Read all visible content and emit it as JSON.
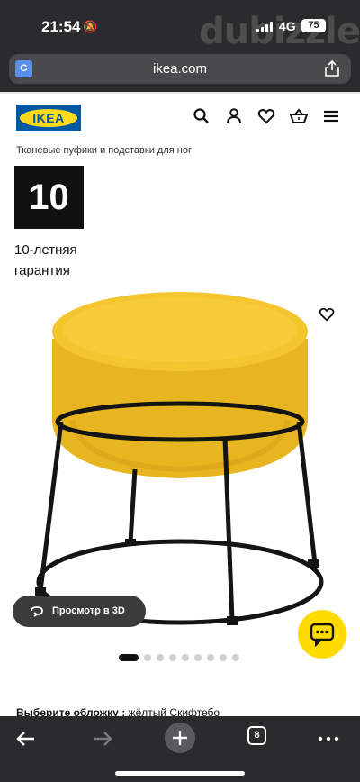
{
  "status": {
    "time": "21:54",
    "network": "4G",
    "battery": "75",
    "watermark": "dubizzle"
  },
  "browser": {
    "url": "ikea.com",
    "tab_count": "8"
  },
  "header": {
    "logo_text": "IKEA",
    "icons": [
      "search-icon",
      "user-icon",
      "heart-icon",
      "cart-icon",
      "menu-icon"
    ]
  },
  "breadcrumb": "Тканевые пуфики и подставки для ног",
  "warranty": {
    "years": "10",
    "text_line1": "10-летняя",
    "text_line2": "гарантия"
  },
  "product": {
    "view_3d_label": "Просмотр в 3D",
    "carousel_total": 9,
    "carousel_active": 0
  },
  "cover": {
    "label": "Выберите обложку :",
    "value": "жёлтый Скифтебо"
  },
  "colors": {
    "ikea_blue": "#0058a3",
    "ikea_yellow": "#ffda1a",
    "pouffe_yellow": "#f2c12e"
  }
}
